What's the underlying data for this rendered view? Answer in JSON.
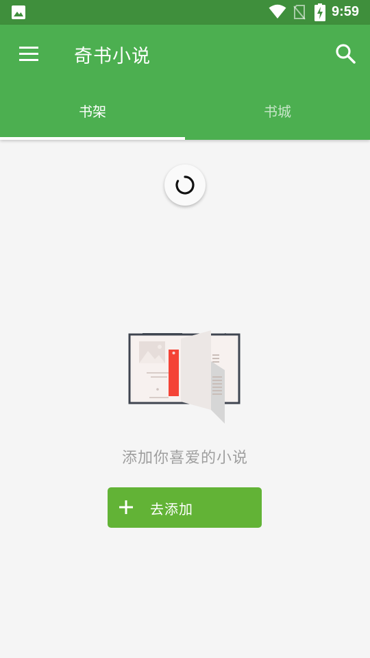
{
  "status_bar": {
    "time": "9:59",
    "icons": [
      "gallery-icon",
      "wifi-icon",
      "no-sim-icon",
      "battery-charging-icon"
    ]
  },
  "app_bar": {
    "title": "奇书小说",
    "menu_icon": "menu-icon",
    "search_icon": "search-icon",
    "color": "#4caf50"
  },
  "tabs": [
    {
      "label": "书架",
      "active": true
    },
    {
      "label": "书城",
      "active": false
    }
  ],
  "main": {
    "loading_icon": "refresh-spinner-icon",
    "empty_illustration": "open-book-illustration",
    "empty_text": "添加你喜爱的小说",
    "add_button": {
      "label": "去添加",
      "icon": "plus-icon",
      "color": "#62b336"
    }
  }
}
